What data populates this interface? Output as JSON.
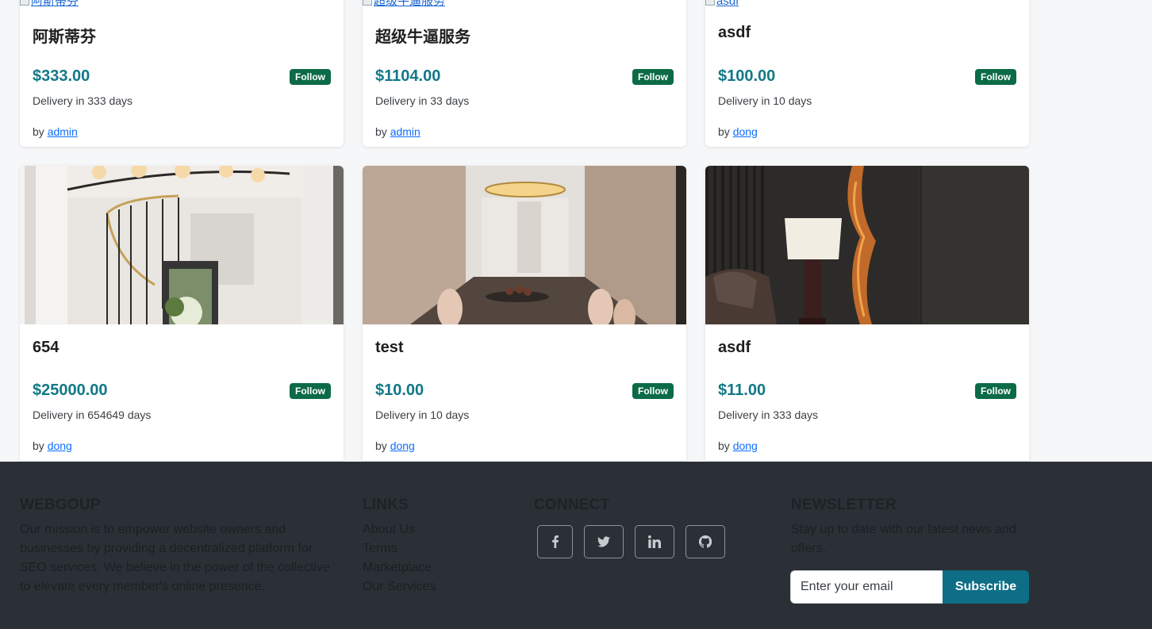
{
  "cards_top": [
    {
      "img_alt": "阿斯蒂芬",
      "title": "阿斯蒂芬",
      "price": "$333.00",
      "follow_label": "Follow",
      "delivery": "Delivery in 333 days",
      "by_prefix": "by",
      "author": "admin"
    },
    {
      "img_alt": "超级牛逼服务",
      "title": "超级牛逼服务",
      "price": "$1104.00",
      "follow_label": "Follow",
      "delivery": "Delivery in 33 days",
      "by_prefix": "by",
      "author": "admin"
    },
    {
      "img_alt": "asdf",
      "title": "asdf",
      "price": "$100.00",
      "follow_label": "Follow",
      "delivery": "Delivery in 10 days",
      "by_prefix": "by",
      "author": "dong"
    }
  ],
  "cards_bottom": [
    {
      "title": "654",
      "price": "$25000.00",
      "follow_label": "Follow",
      "delivery": "Delivery in 654649 days",
      "by_prefix": "by",
      "author": "dong"
    },
    {
      "title": "test",
      "price": "$10.00",
      "follow_label": "Follow",
      "delivery": "Delivery in 10 days",
      "by_prefix": "by",
      "author": "dong"
    },
    {
      "title": "asdf",
      "price": "$11.00",
      "follow_label": "Follow",
      "delivery": "Delivery in 333 days",
      "by_prefix": "by",
      "author": "dong"
    }
  ],
  "footer": {
    "about": {
      "heading": "WEBGOUP",
      "text": "Our mission is to empower website owners and businesses by providing a decentralized platform for SEO services. We believe in the power of the collective to elevate every member's online presence."
    },
    "links": {
      "heading": "LINKS",
      "items": [
        "About Us",
        "Terms",
        "Marketplace",
        "Our Services"
      ]
    },
    "connect": {
      "heading": "CONNECT",
      "icons": [
        "facebook-icon",
        "twitter-icon",
        "linkedin-icon",
        "github-icon"
      ]
    },
    "newsletter": {
      "heading": "NEWSLETTER",
      "text": "Stay up to date with our latest news and offers.",
      "placeholder": "Enter your email",
      "button": "Subscribe"
    }
  },
  "colors": {
    "price": "#127886",
    "follow": "#0c6b47",
    "footer_bg": "#2b3036",
    "subscribe": "#0e6e86",
    "link": "#0d6efd"
  }
}
